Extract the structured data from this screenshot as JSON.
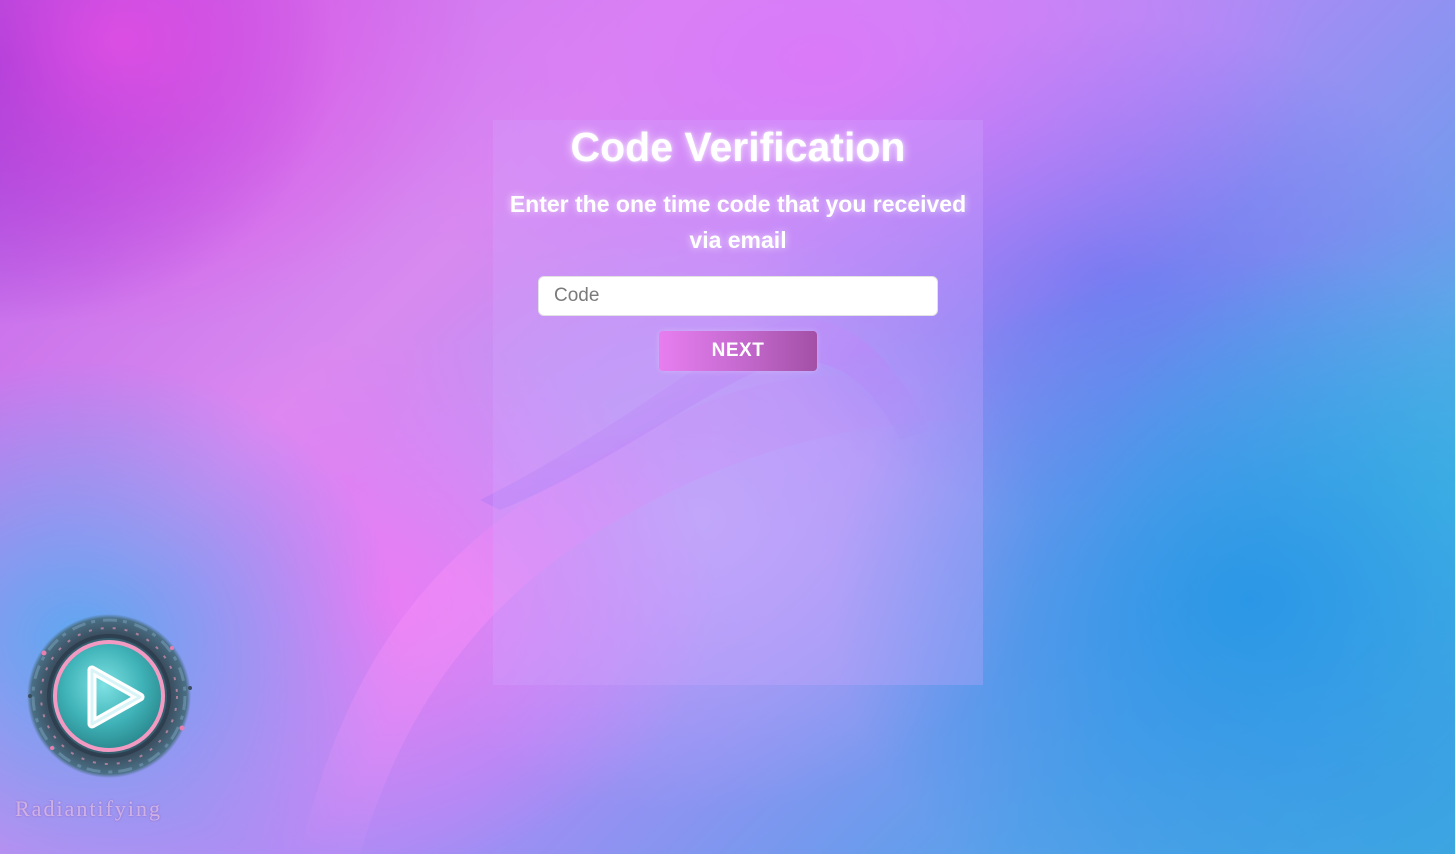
{
  "verification": {
    "title": "Code Verification",
    "subtitle": "Enter the one time code that you received via email",
    "code_placeholder": "Code",
    "code_value": "",
    "next_label": "NEXT"
  },
  "logo": {
    "icon": "play-icon",
    "wordmark": "Radiantifying"
  },
  "colors": {
    "button_gradient_start": "#e77ef0",
    "button_gradient_end": "#a350a6",
    "text": "#ffffff",
    "input_background": "#ffffff"
  }
}
